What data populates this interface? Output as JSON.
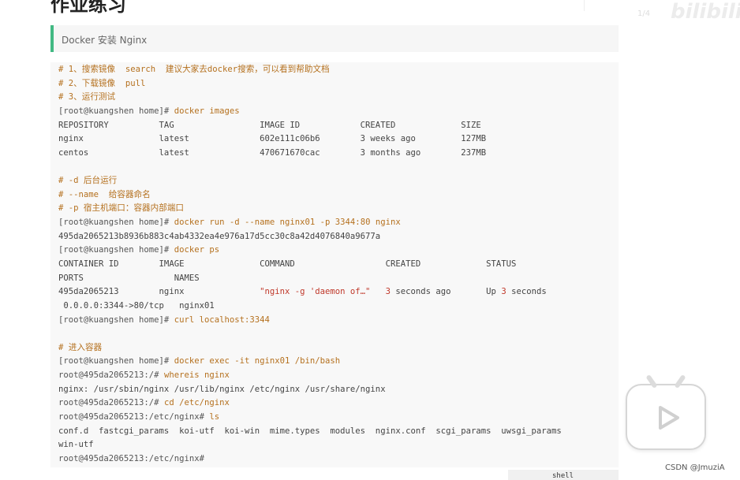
{
  "page": {
    "heading": "作业练习",
    "callout_text": "Docker 安装 Nginx"
  },
  "code": {
    "lines": [
      [
        {
          "t": "# 1、搜索镜像  search  建议大家去docker搜索，可以看到帮助文档",
          "c": "cm"
        }
      ],
      [
        {
          "t": "# 2、下载镜像  pull",
          "c": "cm"
        }
      ],
      [
        {
          "t": "# 3、运行测试",
          "c": "cm"
        }
      ],
      [
        {
          "t": "[root@kuangshen home]# ",
          "c": "pr"
        },
        {
          "t": "docker images",
          "c": "cmd"
        }
      ],
      [
        {
          "t": "REPOSITORY          TAG                 IMAGE ID            CREATED             SIZE",
          "c": ""
        }
      ],
      [
        {
          "t": "nginx               latest              602e111c06b6        3 weeks ago         127MB",
          "c": ""
        }
      ],
      [
        {
          "t": "centos              latest              470671670cac        3 months ago        237MB",
          "c": ""
        }
      ],
      [
        {
          "t": "",
          "c": ""
        }
      ],
      [
        {
          "t": "# -d 后台运行",
          "c": "cm"
        }
      ],
      [
        {
          "t": "# --name  给容器命名",
          "c": "cm"
        }
      ],
      [
        {
          "t": "# -p 宿主机端口：容器内部端口",
          "c": "cm"
        }
      ],
      [
        {
          "t": "[root@kuangshen home]# ",
          "c": "pr"
        },
        {
          "t": "docker run -d --name nginx01 -p 3344:80 nginx",
          "c": "cmd"
        }
      ],
      [
        {
          "t": "495da2065213b8936b883c4ab4332ea4e976a17d5cc30c8a42d4076840a9677a",
          "c": ""
        }
      ],
      [
        {
          "t": "[root@kuangshen home]# ",
          "c": "pr"
        },
        {
          "t": "docker ps",
          "c": "cmd"
        }
      ],
      [
        {
          "t": "CONTAINER ID        IMAGE               COMMAND                  CREATED             STATUS",
          "c": ""
        }
      ],
      [
        {
          "t": "PORTS                  NAMES",
          "c": ""
        }
      ],
      [
        {
          "t": "495da2065213        nginx               ",
          "c": ""
        },
        {
          "t": "\"nginx -g 'daemon of…\"",
          "c": "str"
        },
        {
          "t": "   ",
          "c": ""
        },
        {
          "t": "3",
          "c": "num"
        },
        {
          "t": " seconds ago       Up ",
          "c": ""
        },
        {
          "t": "3",
          "c": "num"
        },
        {
          "t": " seconds",
          "c": ""
        }
      ],
      [
        {
          "t": " 0.0.0.0:3344->80/tcp   nginx01",
          "c": ""
        }
      ],
      [
        {
          "t": "[root@kuangshen home]# ",
          "c": "pr"
        },
        {
          "t": "curl localhost:3344",
          "c": "cmd"
        }
      ],
      [
        {
          "t": "",
          "c": ""
        }
      ],
      [
        {
          "t": "# 进入容器",
          "c": "cm"
        }
      ],
      [
        {
          "t": "[root@kuangshen home]# ",
          "c": "pr"
        },
        {
          "t": "docker exec -it nginx01 /bin/bash",
          "c": "cmd"
        }
      ],
      [
        {
          "t": "root@495da2065213:/# ",
          "c": "pr"
        },
        {
          "t": "whereis nginx",
          "c": "cmd"
        }
      ],
      [
        {
          "t": "nginx: /usr/sbin/nginx /usr/lib/nginx /etc/nginx /usr/share/nginx",
          "c": ""
        }
      ],
      [
        {
          "t": "root@495da2065213:/# ",
          "c": "pr"
        },
        {
          "t": "cd /etc/nginx",
          "c": "cmd"
        }
      ],
      [
        {
          "t": "root@495da2065213:/etc/nginx# ",
          "c": "pr"
        },
        {
          "t": "ls",
          "c": "cmd"
        }
      ],
      [
        {
          "t": "conf.d  fastcgi_params  koi-utf  koi-win  mime.types  modules  nginx.conf  scgi_params  uwsgi_params",
          "c": ""
        }
      ],
      [
        {
          "t": "win-utf",
          "c": ""
        }
      ],
      [
        {
          "t": "root@495da2065213:/etc/nginx#",
          "c": "pr"
        }
      ]
    ],
    "language_label": "shell"
  },
  "watermarks": {
    "site": "bilibili",
    "number": "1/4",
    "csdn": "CSDN @JmuziA"
  },
  "icons": {
    "play_badge": "play-icon"
  },
  "colors": {
    "accent_bar": "#42b983",
    "comment": "#b5711f",
    "string": "#c0392b",
    "code_bg": "#f8f8f8"
  }
}
